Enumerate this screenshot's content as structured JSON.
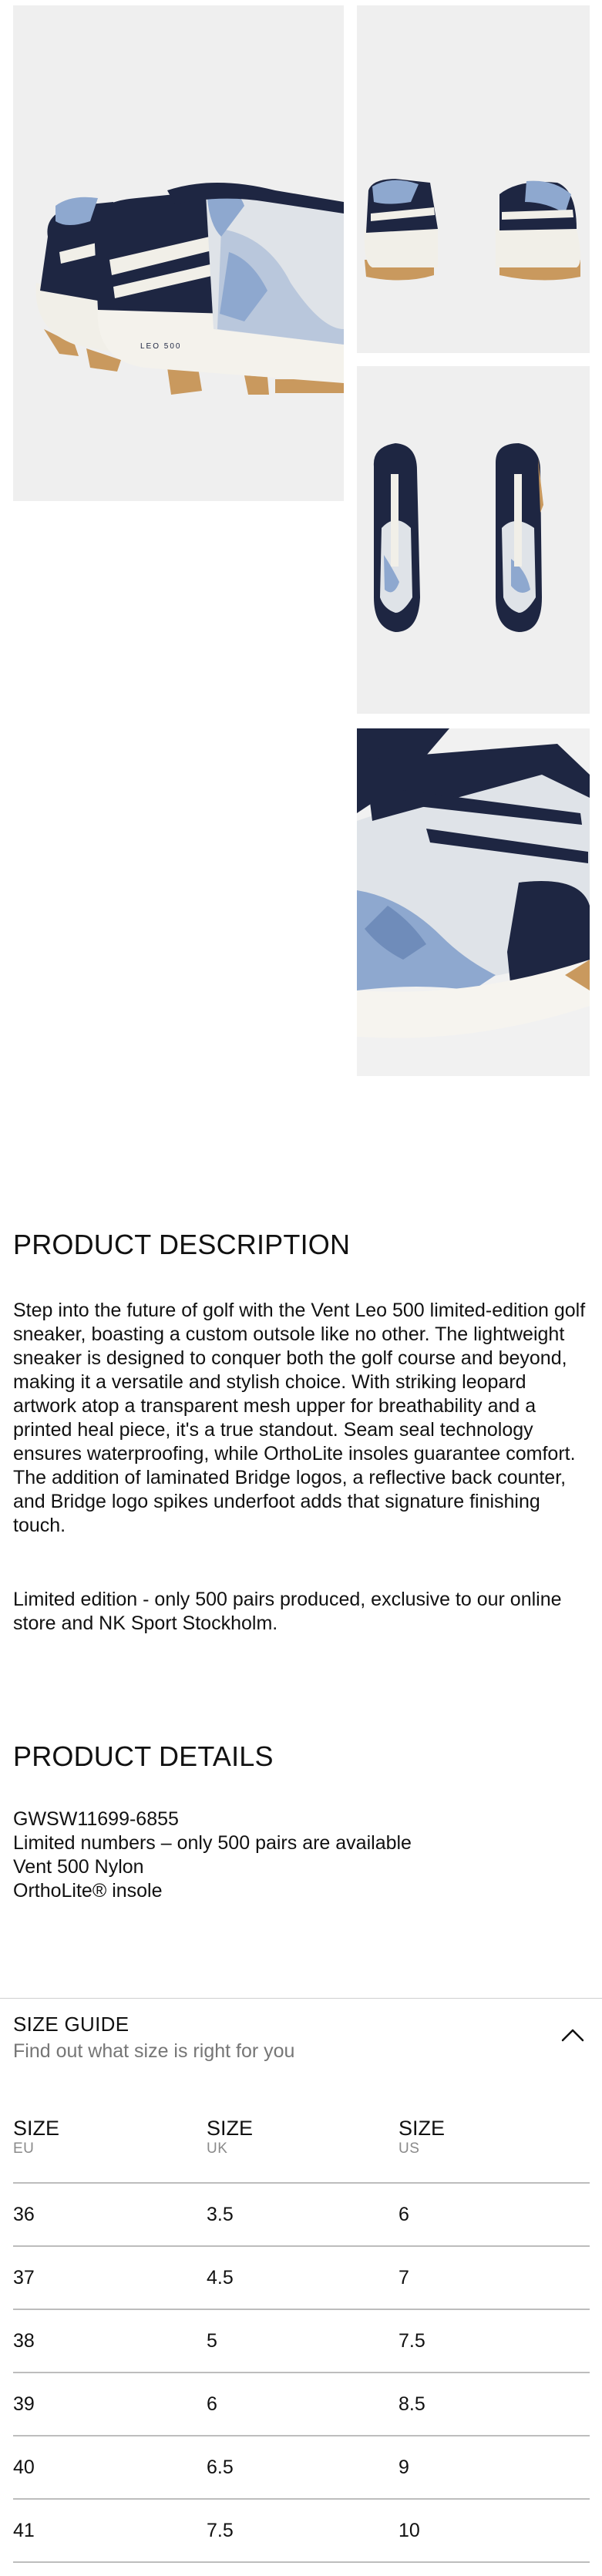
{
  "gallery": {
    "images": [
      {
        "alt": "sneaker-side-view"
      },
      {
        "alt": "sneaker-pair-side"
      },
      {
        "alt": "sneaker-pair-top"
      },
      {
        "alt": "sneaker-closeup"
      }
    ],
    "colors": {
      "navy": "#1e2642",
      "sole": "#f1efe8",
      "mesh": "#dfe3e8",
      "print": "#8ea8cf",
      "gum": "#c9995e",
      "background": "#efefef"
    }
  },
  "description": {
    "title": "PRODUCT DESCRIPTION",
    "paragraph1": "Step into the future of golf with the Vent Leo 500 limited-edition golf sneaker, boasting a custom outsole like no other. The lightweight sneaker is designed to conquer both the golf course and beyond, making it a versatile and stylish choice. With striking leopard artwork atop a transparent mesh upper for breathability and a printed heal piece, it's a true standout. Seam seal technology ensures waterproofing, while OrthoLite insoles guarantee comfort. The addition of laminated Bridge logos, a reflective back counter, and Bridge logo spikes underfoot adds that signature finishing touch.",
    "paragraph2": "Limited edition - only 500 pairs produced, exclusive to our online store and NK Sport Stockholm."
  },
  "details": {
    "title": "PRODUCT DETAILS",
    "items": [
      "GWSW11699-6855",
      "Limited numbers – only 500 pairs are available",
      "Vent 500 Nylon",
      "OrthoLite® insole"
    ]
  },
  "size_guide": {
    "title": "SIZE GUIDE",
    "subtitle": "Find out what size is right for you",
    "toggle_icon": "chevron-up-icon",
    "headers": [
      {
        "label": "SIZE",
        "unit": "EU"
      },
      {
        "label": "SIZE",
        "unit": "UK"
      },
      {
        "label": "SIZE",
        "unit": "US"
      }
    ],
    "rows": [
      [
        "36",
        "3.5",
        "6"
      ],
      [
        "37",
        "4.5",
        "7"
      ],
      [
        "38",
        "5",
        "7.5"
      ],
      [
        "39",
        "6",
        "8.5"
      ],
      [
        "40",
        "6.5",
        "9"
      ],
      [
        "41",
        "7.5",
        "10"
      ]
    ]
  }
}
